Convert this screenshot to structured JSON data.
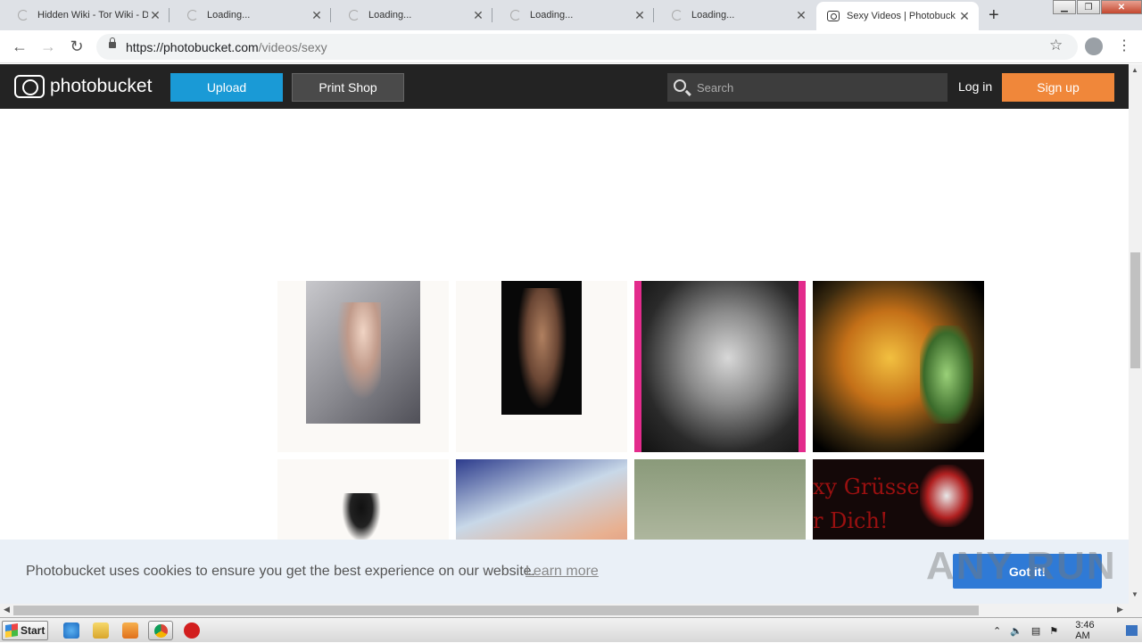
{
  "browser": {
    "tabs": [
      {
        "title": "Hidden Wiki - Tor Wiki - D",
        "active": false
      },
      {
        "title": "Loading...",
        "active": false
      },
      {
        "title": "Loading...",
        "active": false
      },
      {
        "title": "Loading...",
        "active": false
      },
      {
        "title": "Loading...",
        "active": false
      },
      {
        "title": "Sexy Videos | Photobuck",
        "active": true
      }
    ],
    "url_host": "https://photobucket.com",
    "url_path": "/videos/sexy"
  },
  "header": {
    "logo_text": "photobucket",
    "upload_label": "Upload",
    "print_shop_label": "Print Shop",
    "search_placeholder": "Search",
    "login_label": "Log in",
    "signup_label": "Sign up",
    "colors": {
      "upload": "#1a9ad6",
      "signup": "#f0873a",
      "bar": "#232323"
    }
  },
  "grid": {
    "tile8_text": "xy Grüsse\nr Dich!"
  },
  "cookie": {
    "message": "Photobucket uses cookies to ensure you get the best experience on our website.",
    "learn_more": "Learn more",
    "got_it": "Got it!"
  },
  "watermark": "ANY RUN",
  "taskbar": {
    "start_label": "Start",
    "time": "3:46 AM"
  }
}
